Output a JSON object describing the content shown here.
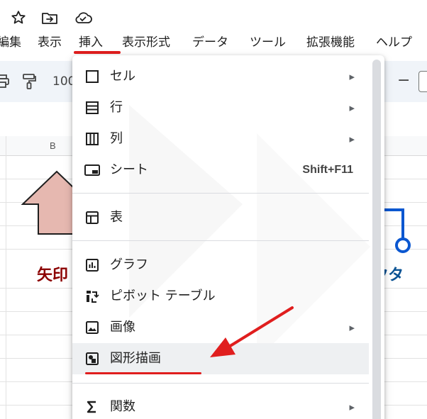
{
  "topbar": {
    "icons": [
      "star-icon",
      "move-to-folder-icon",
      "cloud-saved-icon"
    ]
  },
  "menubar": {
    "items": [
      "編集",
      "表示",
      "挿入",
      "表示形式",
      "データ",
      "ツール",
      "拡張機能",
      "ヘルプ"
    ],
    "active": "挿入"
  },
  "toolbar": {
    "zoom": "100",
    "minus": "−",
    "icons": [
      "print-icon",
      "paint-format-icon"
    ]
  },
  "sheet": {
    "column_b": "B",
    "red_label": "矢印",
    "blue_label": "クタ"
  },
  "insert_menu": {
    "items": [
      {
        "icon": "cell-icon",
        "label": "セル",
        "submenu": true
      },
      {
        "icon": "row-icon",
        "label": "行",
        "submenu": true
      },
      {
        "icon": "column-icon",
        "label": "列",
        "submenu": true
      },
      {
        "icon": "sheet-icon",
        "label": "シート",
        "shortcut": "Shift+F11"
      },
      {
        "icon": "table-icon",
        "label": "表"
      },
      {
        "icon": "chart-icon",
        "label": "グラフ"
      },
      {
        "icon": "pivot-table-icon",
        "label": "ピボット テーブル"
      },
      {
        "icon": "image-icon",
        "label": "画像",
        "submenu": true
      },
      {
        "icon": "drawing-icon",
        "label": "図形描画",
        "highlighted": true
      },
      {
        "icon": "function-icon",
        "label": "関数",
        "submenu": true
      }
    ],
    "submenu_glyph": "▸"
  },
  "annotation_color": "#e01e1e",
  "accent_color": "#0b57d0"
}
